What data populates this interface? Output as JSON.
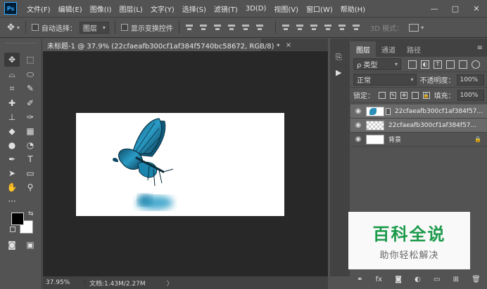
{
  "app": {
    "logo": "Ps"
  },
  "menu": [
    "文件(F)",
    "编辑(E)",
    "图像(I)",
    "图层(L)",
    "文字(Y)",
    "选择(S)",
    "滤镜(T)",
    "3D(D)",
    "视图(V)",
    "窗口(W)",
    "帮助(H)"
  ],
  "window_controls": {
    "minimize": "—",
    "maximize": "□",
    "close": "✕"
  },
  "options_bar": {
    "auto_select_label": "自动选择：",
    "auto_select_value": "图层",
    "show_transform_label": "显示变换控件",
    "mode_label": "3D 模式："
  },
  "document": {
    "tab_title": "未标题-1 @ 37.9% (22cfaeafb300cf1af384f5740bc58672, RGB/8) *",
    "close": "×",
    "zoom": "37.95%",
    "doc_info": "文档:1.43M/2.27M",
    "status_arrow": "〉"
  },
  "layers_panel": {
    "tabs": [
      "图层",
      "通道",
      "路径"
    ],
    "filter_kind": "ρ 类型",
    "blend_mode": "正常",
    "opacity_label": "不透明度：",
    "opacity_value": "100%",
    "lock_label": "锁定：",
    "fill_label": "填充：",
    "fill_value": "100%",
    "layers": [
      {
        "name": "22cfaeafb300cf1af384f57...",
        "visible": true
      },
      {
        "name": "22cfaeafb300cf1af384f57...",
        "visible": true
      },
      {
        "name": "背景",
        "visible": true
      }
    ]
  },
  "watermark": {
    "title": "百科全说",
    "subtitle": "助你轻松解决"
  },
  "colors": {
    "accent": "#31a8ff",
    "watermark_green": "#1b9a4a",
    "butterfly": "#2a8fb6"
  },
  "icons": {
    "move": "move-icon",
    "marquee": "marquee-icon",
    "lasso": "lasso-icon",
    "quick-select": "quick-select-icon",
    "crop": "crop-icon",
    "eyedropper": "eyedropper-icon",
    "healing": "healing-brush-icon",
    "brush": "brush-icon",
    "stamp": "clone-stamp-icon",
    "history-brush": "history-brush-icon",
    "eraser": "eraser-icon",
    "gradient": "gradient-icon",
    "blur": "blur-icon",
    "dodge": "dodge-icon",
    "pen": "pen-icon",
    "type": "type-icon",
    "path-select": "path-select-icon",
    "shape": "rectangle-shape-icon",
    "hand": "hand-icon",
    "zoom": "zoom-icon"
  }
}
